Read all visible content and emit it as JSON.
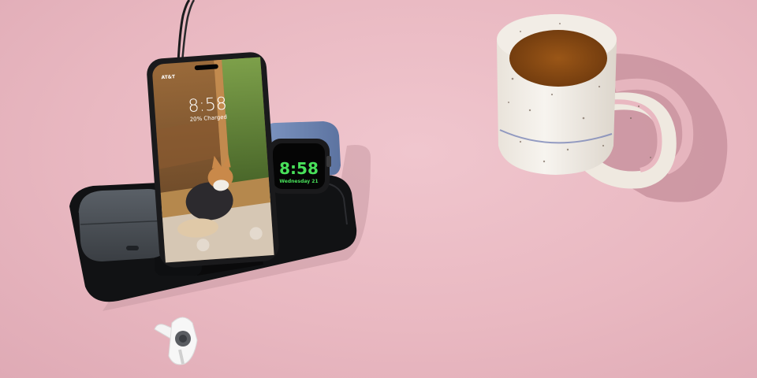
{
  "scene": {
    "background_color": "#e9b8c1",
    "objects": [
      "wireless-charging-stand",
      "smartphone",
      "smartwatch",
      "earbuds-case",
      "earbud",
      "coffee-mug",
      "charging-cable"
    ]
  },
  "phone": {
    "carrier": "AT&T",
    "time": "8:58",
    "status": "20% Charged"
  },
  "watch": {
    "time": "8:58",
    "date": "Wednesday 21",
    "accent_color": "#48e05a"
  },
  "colors": {
    "charger": "#111214",
    "earbuds_case": "#4a4f55",
    "watch_band": "#6f87b3",
    "mug": "#f3efe8",
    "coffee": "#8a4a12"
  }
}
